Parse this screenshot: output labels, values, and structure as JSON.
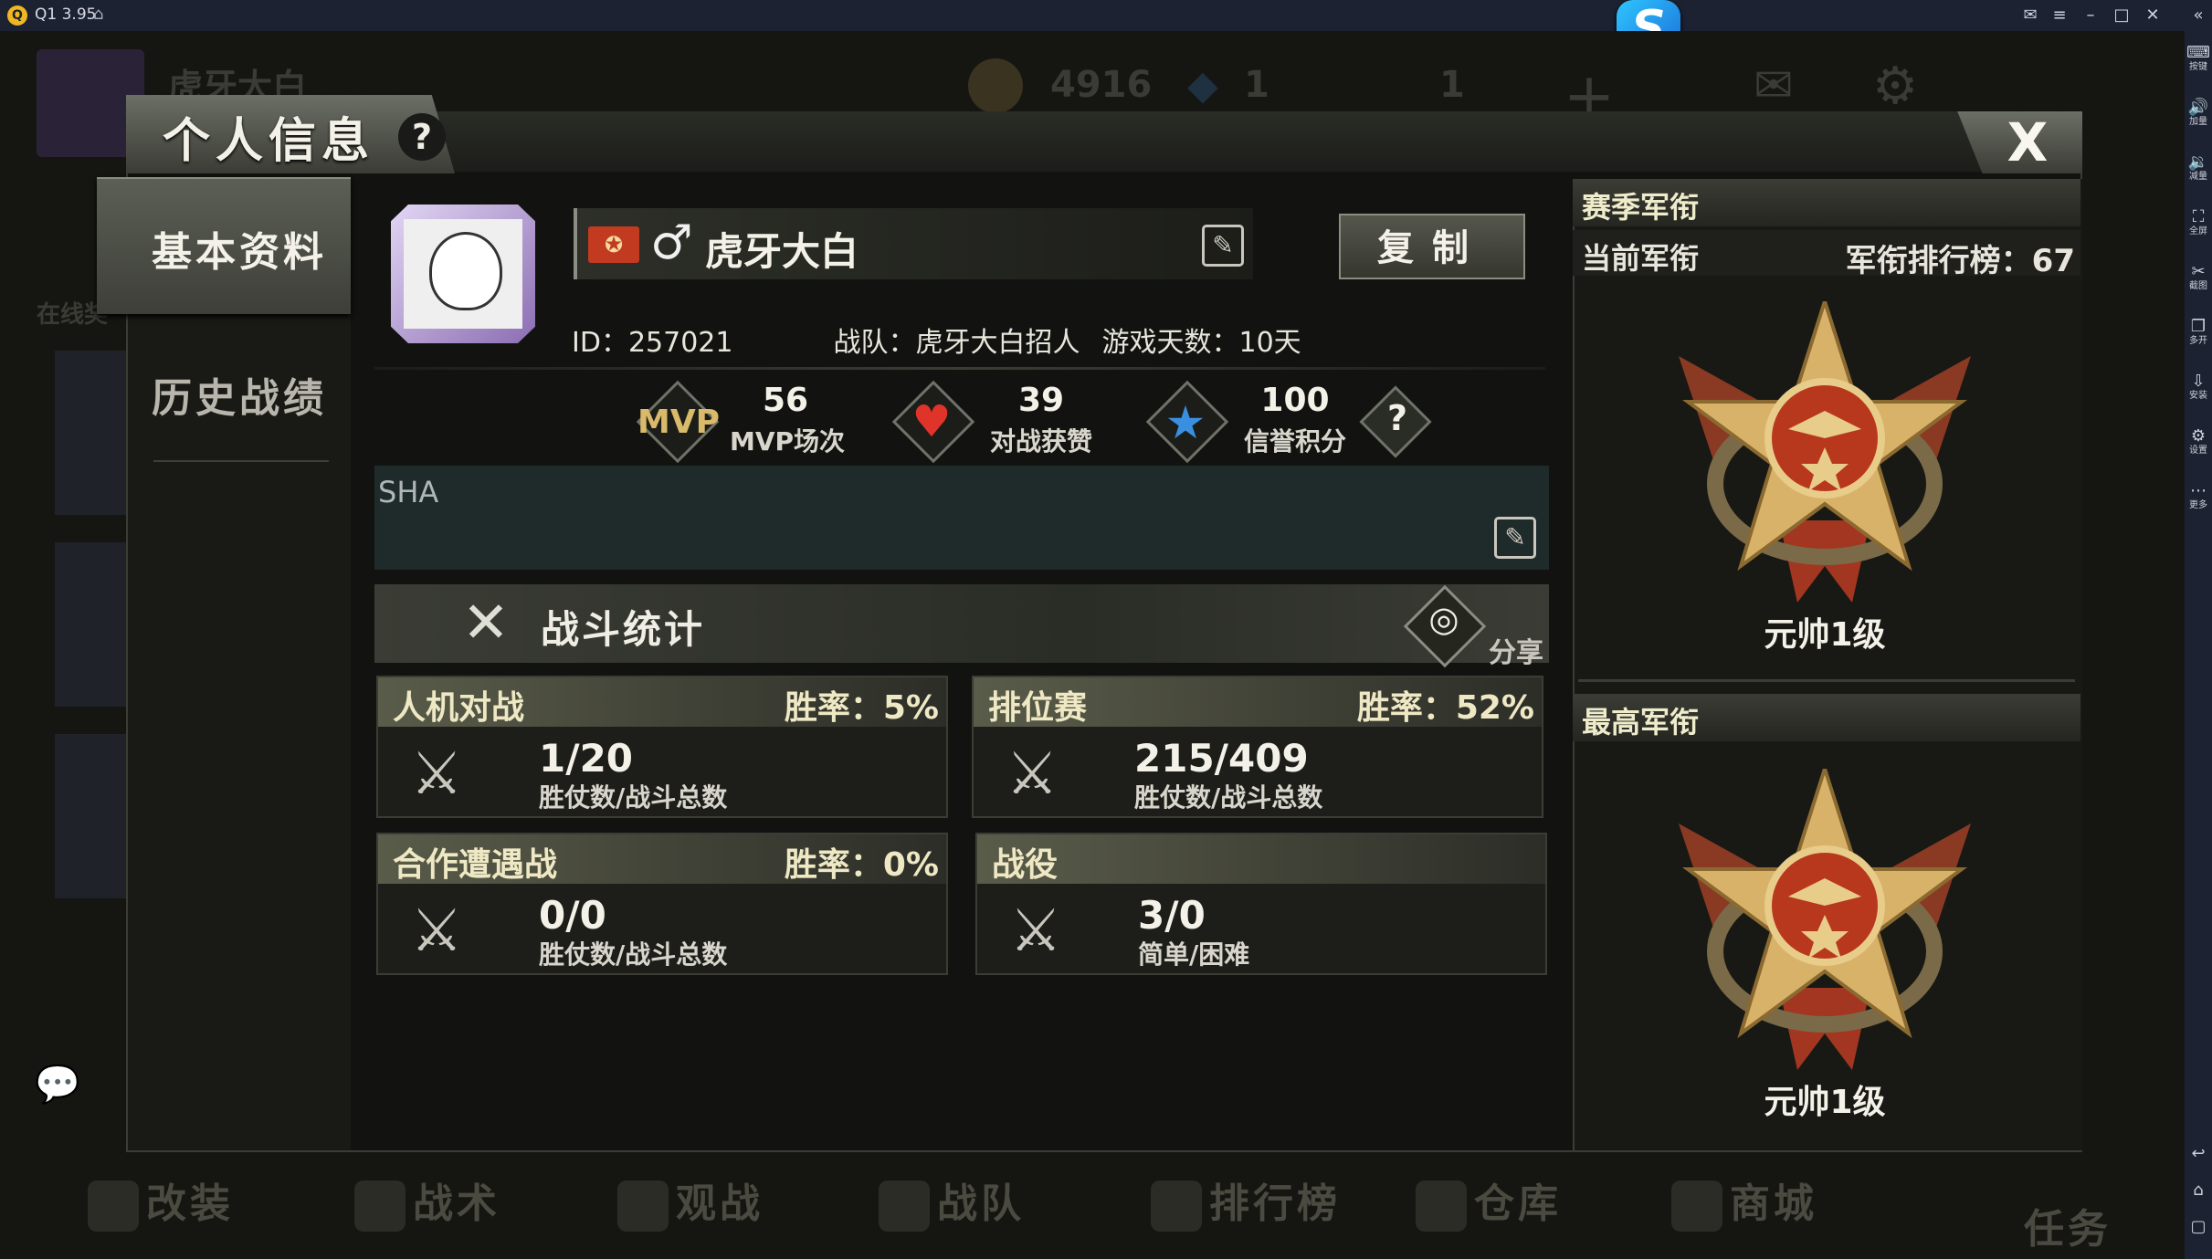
{
  "emulator": {
    "title": "Q1 3.95",
    "side_tools": [
      {
        "icon": "keyboard-icon",
        "label": "按键"
      },
      {
        "icon": "volume-up-icon",
        "label": "加量"
      },
      {
        "icon": "volume-down-icon",
        "label": "减量"
      },
      {
        "icon": "fullscreen-icon",
        "label": "全屏"
      },
      {
        "icon": "scissors-icon",
        "label": "截图"
      },
      {
        "icon": "multi-open-icon",
        "label": "多开"
      },
      {
        "icon": "install-icon",
        "label": "安装"
      },
      {
        "icon": "settings-icon",
        "label": "设置"
      },
      {
        "icon": "more-icon",
        "label": "更多"
      }
    ]
  },
  "background": {
    "player_name": "虎牙大白",
    "coins": "4916",
    "diamonds": "1",
    "cards": "1",
    "left_label": "在线奖",
    "bottom_nav": [
      "改装",
      "战术",
      "观战",
      "战队",
      "排行榜",
      "仓库",
      "商城"
    ],
    "task_label": "任务"
  },
  "dialog": {
    "title": "个人信息",
    "help": "?",
    "close": "X"
  },
  "tabs": {
    "basic": "基本资料",
    "history": "历史战绩"
  },
  "profile": {
    "name": "虎牙大白",
    "gender": "♂",
    "copy_label": "复制",
    "id_text": "ID：257021",
    "team_text": "战队：虎牙大白招人",
    "days_text": "游戏天数：10天"
  },
  "badges": {
    "mvp": {
      "icon_text": "MVP",
      "value": "56",
      "label": "MVP场次"
    },
    "likes": {
      "value": "39",
      "label": "对战获赞"
    },
    "credit": {
      "value": "100",
      "label": "信誉积分"
    },
    "help": "?"
  },
  "signature": {
    "text": "SHA"
  },
  "battle": {
    "title": "战斗统计",
    "share_label": "分享",
    "cards": [
      {
        "title": "人机对战",
        "rate": "胜率：5%",
        "value": "1/20",
        "sub": "胜仗数/战斗总数"
      },
      {
        "title": "排位赛",
        "rate": "胜率：52%",
        "value": "215/409",
        "sub": "胜仗数/战斗总数"
      },
      {
        "title": "合作遭遇战",
        "rate": "胜率：0%",
        "value": "0/0",
        "sub": "胜仗数/战斗总数"
      },
      {
        "title": "战役",
        "rate": "",
        "value": "3/0",
        "sub": "简单/困难"
      }
    ]
  },
  "rank": {
    "season_title": "赛季军衔",
    "current_label": "当前军衔",
    "leaderboard_text": "军衔排行榜：67",
    "current_rank": "元帅1级",
    "highest_title": "最高军衔",
    "highest_rank": "元帅1级"
  },
  "colors": {
    "card_header": "#5a5c4a",
    "accent_text": "#efe8c4",
    "heart": "#e0342a",
    "star": "#3a8fe0",
    "medal_red": "#b8381e",
    "medal_gold": "#d9b26a"
  }
}
